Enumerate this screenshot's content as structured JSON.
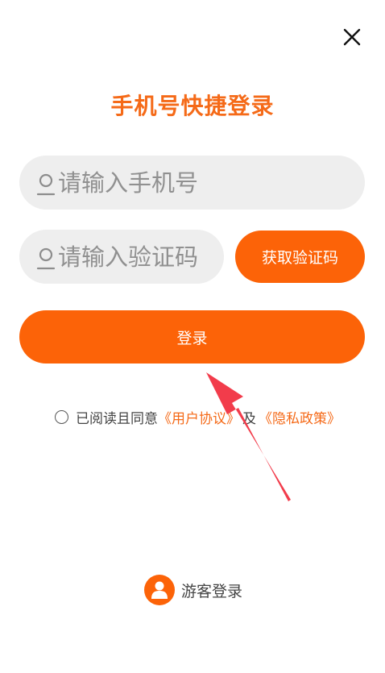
{
  "header": {
    "title": "手机号快捷登录"
  },
  "phone_field": {
    "placeholder": "请输入手机号",
    "value": ""
  },
  "code_field": {
    "placeholder": "请输入验证码",
    "value": ""
  },
  "buttons": {
    "get_code": "获取验证码",
    "login": "登录"
  },
  "agreement": {
    "checked": false,
    "prefix": "已阅读且同意",
    "user_agreement": "《用户协议》",
    "and": "及",
    "privacy_policy": "《隐私政策》"
  },
  "guest": {
    "label": "游客登录"
  },
  "icons": {
    "close": "close-icon",
    "field_person": "person-outline-icon",
    "guest_avatar": "user-avatar-icon",
    "radio": "radio-unchecked-icon",
    "annotation": "red-arrow-icon"
  },
  "colors": {
    "accent": "#fc6308",
    "title": "#f56a18",
    "field_bg": "#eeeeee",
    "annotation": "#f23c4b"
  }
}
